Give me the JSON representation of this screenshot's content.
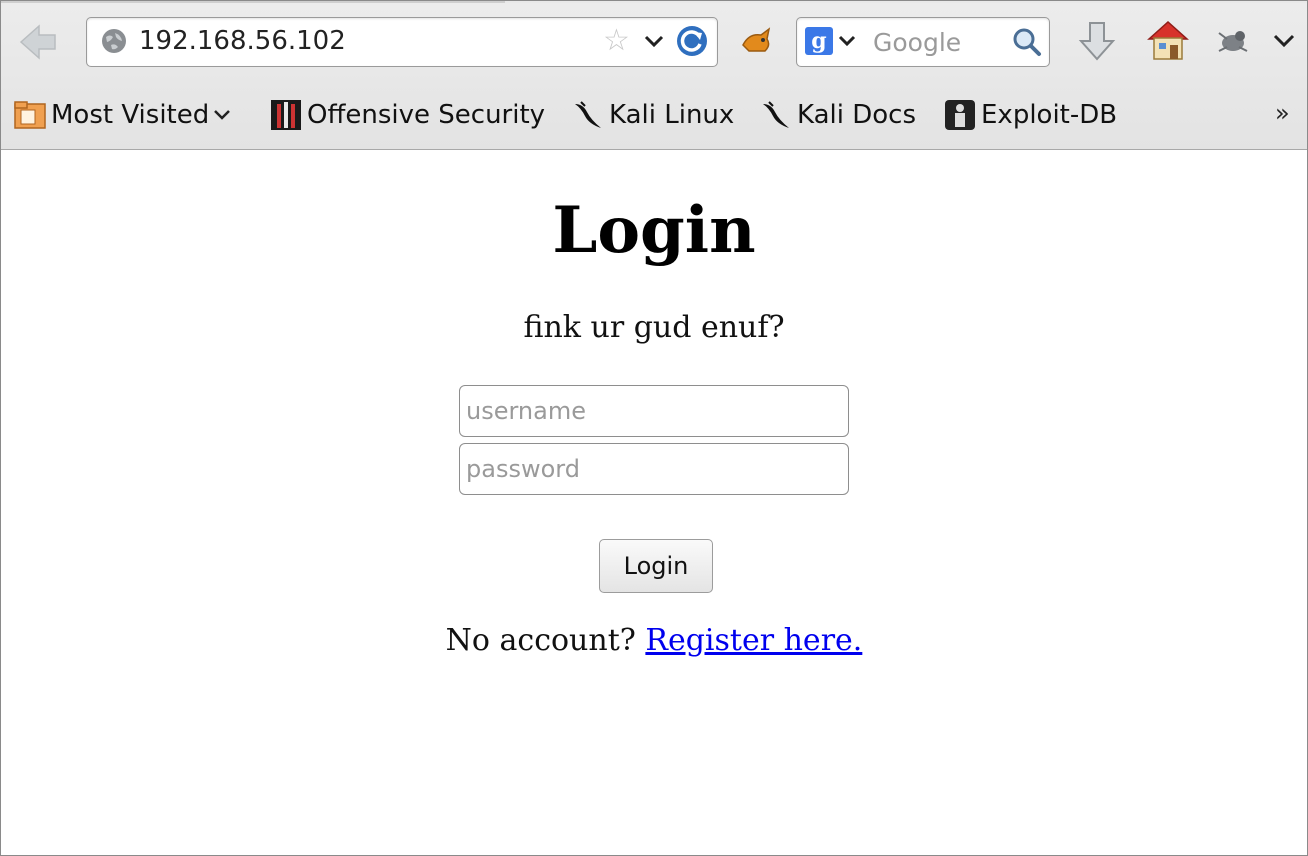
{
  "browser": {
    "url": "192.168.56.102",
    "search_placeholder": "Google",
    "bookmarks": [
      {
        "label": "Most Visited"
      },
      {
        "label": "Offensive Security"
      },
      {
        "label": "Kali Linux"
      },
      {
        "label": "Kali Docs"
      },
      {
        "label": "Exploit-DB"
      }
    ],
    "overflow_label": "»"
  },
  "login": {
    "heading": "Login",
    "tagline": "fink ur gud enuf?",
    "username_placeholder": "username",
    "password_placeholder": "password",
    "submit_label": "Login",
    "no_account_text": "No account?",
    "register_link": "Register here."
  },
  "colors": {
    "link": "#0000ee",
    "chrome": "#e6e6e6"
  }
}
